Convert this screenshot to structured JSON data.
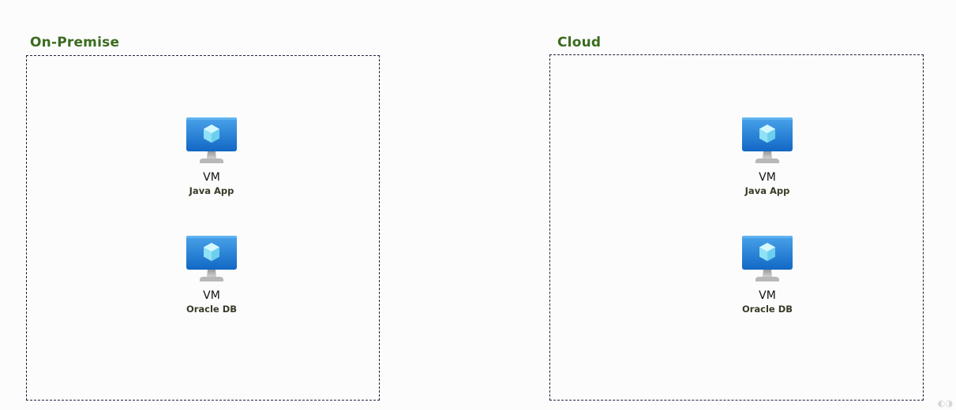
{
  "groups": {
    "on_premise": {
      "title": "On-Premise",
      "nodes": [
        {
          "label": "VM",
          "sublabel": "Java App",
          "icon": "azure-vm-icon"
        },
        {
          "label": "VM",
          "sublabel": "Oracle DB",
          "icon": "azure-vm-icon"
        }
      ]
    },
    "cloud": {
      "title": "Cloud",
      "nodes": [
        {
          "label": "VM",
          "sublabel": "Java App",
          "icon": "azure-vm-icon"
        },
        {
          "label": "VM",
          "sublabel": "Oracle DB",
          "icon": "azure-vm-icon"
        }
      ]
    }
  },
  "colors": {
    "group_title": "#3b6b1f",
    "border": "#1e2440",
    "monitor_blue": "#1f7ad6",
    "cube": "#7fd8f0"
  }
}
